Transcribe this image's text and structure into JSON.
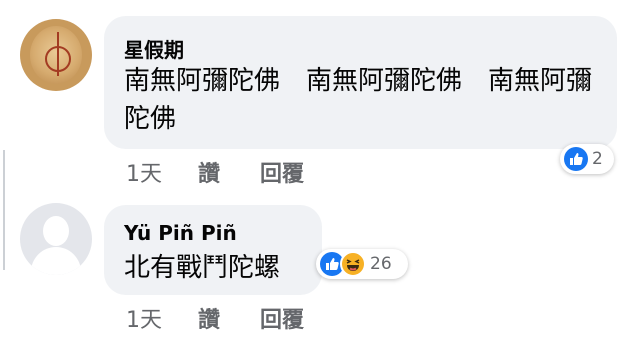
{
  "comments": [
    {
      "author": "星假期",
      "text": "南無阿彌陀佛　南無阿彌陀佛　南無阿彌陀佛",
      "time": "1天",
      "like_label": "讚",
      "reply_label": "回覆",
      "reaction_count": "2",
      "reactions": [
        "like-icon"
      ]
    },
    {
      "author": "Yü Piñ Piñ",
      "text": "北有戰鬥陀螺",
      "time": "1天",
      "like_label": "讚",
      "reply_label": "回覆",
      "reaction_count": "26",
      "reactions": [
        "like-icon",
        "haha-icon"
      ]
    }
  ],
  "colors": {
    "bubble": "#f0f2f5",
    "like_blue": "#1877f2",
    "haha_yellow": "#f7b125",
    "meta_gray": "#65676b"
  }
}
